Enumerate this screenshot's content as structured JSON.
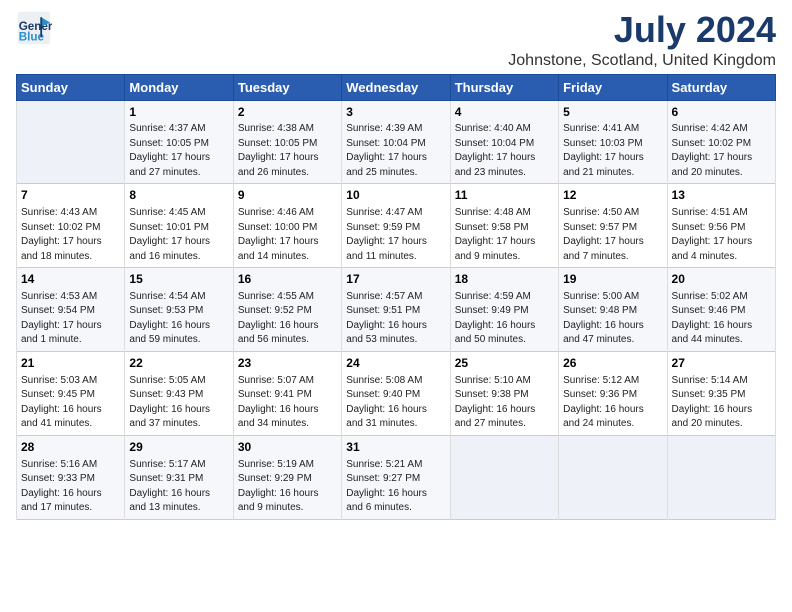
{
  "logo": {
    "line1": "General",
    "line2": "Blue"
  },
  "title": "July 2024",
  "location": "Johnstone, Scotland, United Kingdom",
  "days_of_week": [
    "Sunday",
    "Monday",
    "Tuesday",
    "Wednesday",
    "Thursday",
    "Friday",
    "Saturday"
  ],
  "weeks": [
    [
      {
        "day": "",
        "content": ""
      },
      {
        "day": "1",
        "content": "Sunrise: 4:37 AM\nSunset: 10:05 PM\nDaylight: 17 hours\nand 27 minutes."
      },
      {
        "day": "2",
        "content": "Sunrise: 4:38 AM\nSunset: 10:05 PM\nDaylight: 17 hours\nand 26 minutes."
      },
      {
        "day": "3",
        "content": "Sunrise: 4:39 AM\nSunset: 10:04 PM\nDaylight: 17 hours\nand 25 minutes."
      },
      {
        "day": "4",
        "content": "Sunrise: 4:40 AM\nSunset: 10:04 PM\nDaylight: 17 hours\nand 23 minutes."
      },
      {
        "day": "5",
        "content": "Sunrise: 4:41 AM\nSunset: 10:03 PM\nDaylight: 17 hours\nand 21 minutes."
      },
      {
        "day": "6",
        "content": "Sunrise: 4:42 AM\nSunset: 10:02 PM\nDaylight: 17 hours\nand 20 minutes."
      }
    ],
    [
      {
        "day": "7",
        "content": "Sunrise: 4:43 AM\nSunset: 10:02 PM\nDaylight: 17 hours\nand 18 minutes."
      },
      {
        "day": "8",
        "content": "Sunrise: 4:45 AM\nSunset: 10:01 PM\nDaylight: 17 hours\nand 16 minutes."
      },
      {
        "day": "9",
        "content": "Sunrise: 4:46 AM\nSunset: 10:00 PM\nDaylight: 17 hours\nand 14 minutes."
      },
      {
        "day": "10",
        "content": "Sunrise: 4:47 AM\nSunset: 9:59 PM\nDaylight: 17 hours\nand 11 minutes."
      },
      {
        "day": "11",
        "content": "Sunrise: 4:48 AM\nSunset: 9:58 PM\nDaylight: 17 hours\nand 9 minutes."
      },
      {
        "day": "12",
        "content": "Sunrise: 4:50 AM\nSunset: 9:57 PM\nDaylight: 17 hours\nand 7 minutes."
      },
      {
        "day": "13",
        "content": "Sunrise: 4:51 AM\nSunset: 9:56 PM\nDaylight: 17 hours\nand 4 minutes."
      }
    ],
    [
      {
        "day": "14",
        "content": "Sunrise: 4:53 AM\nSunset: 9:54 PM\nDaylight: 17 hours\nand 1 minute."
      },
      {
        "day": "15",
        "content": "Sunrise: 4:54 AM\nSunset: 9:53 PM\nDaylight: 16 hours\nand 59 minutes."
      },
      {
        "day": "16",
        "content": "Sunrise: 4:55 AM\nSunset: 9:52 PM\nDaylight: 16 hours\nand 56 minutes."
      },
      {
        "day": "17",
        "content": "Sunrise: 4:57 AM\nSunset: 9:51 PM\nDaylight: 16 hours\nand 53 minutes."
      },
      {
        "day": "18",
        "content": "Sunrise: 4:59 AM\nSunset: 9:49 PM\nDaylight: 16 hours\nand 50 minutes."
      },
      {
        "day": "19",
        "content": "Sunrise: 5:00 AM\nSunset: 9:48 PM\nDaylight: 16 hours\nand 47 minutes."
      },
      {
        "day": "20",
        "content": "Sunrise: 5:02 AM\nSunset: 9:46 PM\nDaylight: 16 hours\nand 44 minutes."
      }
    ],
    [
      {
        "day": "21",
        "content": "Sunrise: 5:03 AM\nSunset: 9:45 PM\nDaylight: 16 hours\nand 41 minutes."
      },
      {
        "day": "22",
        "content": "Sunrise: 5:05 AM\nSunset: 9:43 PM\nDaylight: 16 hours\nand 37 minutes."
      },
      {
        "day": "23",
        "content": "Sunrise: 5:07 AM\nSunset: 9:41 PM\nDaylight: 16 hours\nand 34 minutes."
      },
      {
        "day": "24",
        "content": "Sunrise: 5:08 AM\nSunset: 9:40 PM\nDaylight: 16 hours\nand 31 minutes."
      },
      {
        "day": "25",
        "content": "Sunrise: 5:10 AM\nSunset: 9:38 PM\nDaylight: 16 hours\nand 27 minutes."
      },
      {
        "day": "26",
        "content": "Sunrise: 5:12 AM\nSunset: 9:36 PM\nDaylight: 16 hours\nand 24 minutes."
      },
      {
        "day": "27",
        "content": "Sunrise: 5:14 AM\nSunset: 9:35 PM\nDaylight: 16 hours\nand 20 minutes."
      }
    ],
    [
      {
        "day": "28",
        "content": "Sunrise: 5:16 AM\nSunset: 9:33 PM\nDaylight: 16 hours\nand 17 minutes."
      },
      {
        "day": "29",
        "content": "Sunrise: 5:17 AM\nSunset: 9:31 PM\nDaylight: 16 hours\nand 13 minutes."
      },
      {
        "day": "30",
        "content": "Sunrise: 5:19 AM\nSunset: 9:29 PM\nDaylight: 16 hours\nand 9 minutes."
      },
      {
        "day": "31",
        "content": "Sunrise: 5:21 AM\nSunset: 9:27 PM\nDaylight: 16 hours\nand 6 minutes."
      },
      {
        "day": "",
        "content": ""
      },
      {
        "day": "",
        "content": ""
      },
      {
        "day": "",
        "content": ""
      }
    ]
  ]
}
